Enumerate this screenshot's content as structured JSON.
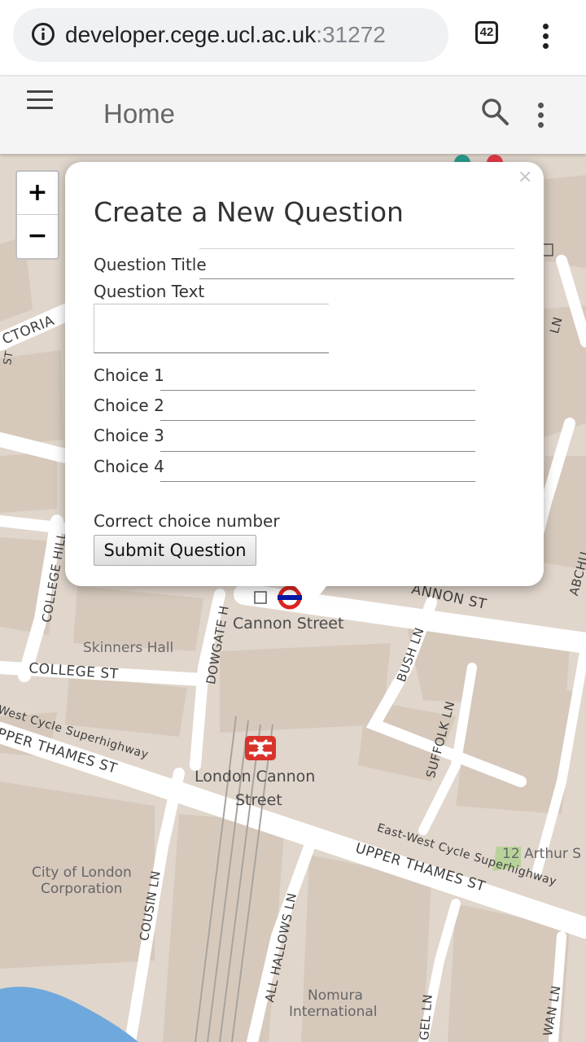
{
  "browser": {
    "url_host": "developer.cege.ucl.ac.uk",
    "url_port": ":31272",
    "tab_count": "42"
  },
  "app_bar": {
    "title": "Home"
  },
  "zoom": {
    "in_label": "+",
    "out_label": "−"
  },
  "popup": {
    "close_label": "×",
    "title": "Create a New Question",
    "fields": {
      "question_title_label": "Question Title",
      "question_text_label": "Question Text",
      "choice1_label": "Choice 1",
      "choice2_label": "Choice 2",
      "choice3_label": "Choice 3",
      "choice4_label": "Choice 4",
      "correct_choice_label": "Correct choice number"
    },
    "submit_label": "Submit Question"
  },
  "map": {
    "places": {
      "cannon_street": "Cannon Street",
      "skinners_hall": "Skinners Hall",
      "london_cannon_street_1": "London Cannon",
      "london_cannon_street_2": "Street",
      "city_of_london_1": "City of London",
      "city_of_london_2": "Corporation",
      "arthur": "12 Arthur S",
      "nomura_1": "Nomura",
      "nomura_2": "International"
    },
    "streets": {
      "victoria": "CTORIA",
      "college_hill": "COLLEGE HILL",
      "college_st": "COLLEGE ST",
      "dowgate": "DOWGATE H",
      "cannon_st": "ANNON ST",
      "bush_ln": "BUSH LN",
      "suffolk_ln": "SUFFOLK LN",
      "upper_thames_left": "PPER THAMES ST",
      "cycle_left": "West Cycle Superhighway",
      "upper_thames_right": "UPPER THAMES ST",
      "cycle_right": "East-West Cycle Superhighway",
      "cousin_ln": "COUSIN LN",
      "all_hallows": "ALL HALLOWS LN",
      "abchurch": "ABCHU",
      "ln_top": "LN",
      "gel_ln": "GEL LN",
      "wan_ln": "WAN LN",
      "st_left": "ST"
    }
  }
}
